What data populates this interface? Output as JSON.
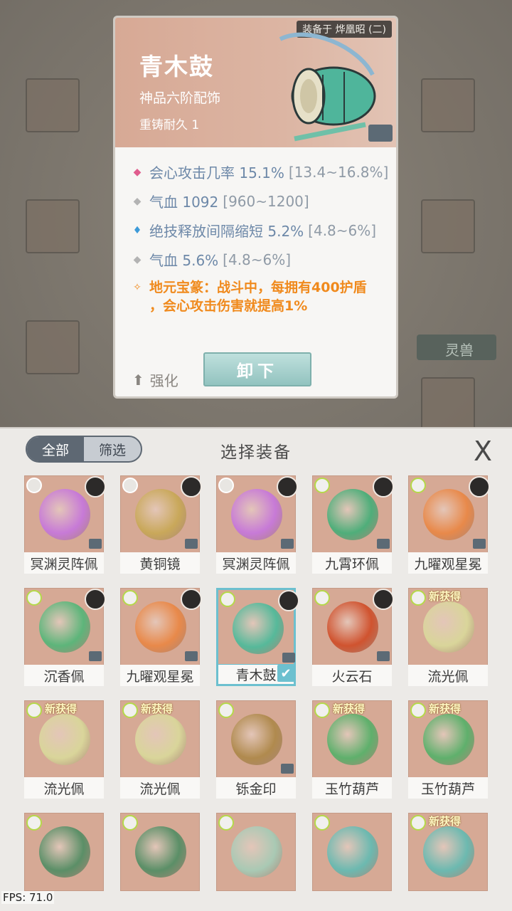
{
  "detail": {
    "equipped_by": "装备于 烨凰昭 (二)",
    "name": "青木鼓",
    "grade": "神品六阶配饰",
    "durability": "重铸耐久 1",
    "stats": [
      {
        "icon": "pink-diamond-icon",
        "color": "#e05c8d",
        "text": "会心攻击几率 15.1%",
        "range": "[13.4~16.8%]"
      },
      {
        "icon": "gray-diamond-icon",
        "color": "#b3b3b3",
        "text": "气血 1092",
        "range": "[960~1200]"
      },
      {
        "icon": "blue-flame-icon",
        "color": "#3d9ad8",
        "text": "绝技释放间隔缩短 5.2%",
        "range": "[4.8~6%]"
      },
      {
        "icon": "gray-diamond-icon",
        "color": "#b3b3b3",
        "text": "气血 5.6%",
        "range": "[4.8~6%]"
      }
    ],
    "special_line1": "地元宝篆：战斗中，每拥有400护盾",
    "special_line2": "，会心攻击伤害就提高1%",
    "enhance_label": "强化",
    "unequip_label": "卸下"
  },
  "background": {
    "tab_label": "灵兽"
  },
  "panel": {
    "filter_all": "全部",
    "filter_screen": "筛选",
    "title": "选择装备",
    "close_label": "X",
    "items": [
      {
        "label": "冥渊灵阵佩",
        "icon": "purple-orb-icon",
        "badge": "white",
        "avatar": true,
        "new": "",
        "locked": true,
        "gem_color": "#c77ad7",
        "selected": false
      },
      {
        "label": "黄铜镜",
        "icon": "bronze-mirror-icon",
        "badge": "white",
        "avatar": true,
        "new": "",
        "locked": true,
        "gem_color": "#c9a85a",
        "selected": false
      },
      {
        "label": "冥渊灵阵佩",
        "icon": "purple-orb-icon",
        "badge": "white",
        "avatar": true,
        "new": "",
        "locked": true,
        "gem_color": "#c77ad7",
        "selected": false
      },
      {
        "label": "九霄环佩",
        "icon": "jade-ring-icon",
        "badge": "green",
        "avatar": true,
        "new": "",
        "locked": true,
        "gem_color": "#4fae7a",
        "selected": false
      },
      {
        "label": "九曜观星冕",
        "icon": "flame-crown-icon",
        "badge": "green",
        "avatar": true,
        "new": "",
        "locked": true,
        "gem_color": "#e8894a",
        "selected": false
      },
      {
        "label": "沉香佩",
        "icon": "jade-pendant-icon",
        "badge": "green",
        "avatar": true,
        "new": "",
        "locked": true,
        "gem_color": "#5db57a",
        "selected": false
      },
      {
        "label": "九曜观星冕",
        "icon": "flame-crown-icon",
        "badge": "green",
        "avatar": true,
        "new": "",
        "locked": true,
        "gem_color": "#e8894a",
        "selected": false
      },
      {
        "label": "青木鼓",
        "icon": "drum-icon",
        "badge": "green",
        "avatar": true,
        "new": "",
        "locked": true,
        "gem_color": "#56b99a",
        "selected": true
      },
      {
        "label": "火云石",
        "icon": "fire-crystal-icon",
        "badge": "green",
        "avatar": true,
        "new": "",
        "locked": true,
        "gem_color": "#d0532f",
        "selected": false
      },
      {
        "label": "流光佩",
        "icon": "light-disc-icon",
        "badge": "green",
        "avatar": false,
        "new": "新获得",
        "locked": false,
        "gem_color": "#d9d59a",
        "selected": false
      },
      {
        "label": "流光佩",
        "icon": "light-disc-icon",
        "badge": "green",
        "avatar": false,
        "new": "新获得",
        "locked": false,
        "gem_color": "#d9d59a",
        "selected": false
      },
      {
        "label": "流光佩",
        "icon": "light-disc-icon",
        "badge": "green",
        "avatar": false,
        "new": "新获得",
        "locked": false,
        "gem_color": "#d9d59a",
        "selected": false
      },
      {
        "label": "铄金印",
        "icon": "golden-seal-icon",
        "badge": "green",
        "avatar": false,
        "new": "",
        "locked": true,
        "gem_color": "#b08a4e",
        "selected": false
      },
      {
        "label": "玉竹葫芦",
        "icon": "gourd-icon",
        "badge": "green",
        "avatar": false,
        "new": "新获得",
        "locked": false,
        "gem_color": "#5fb06c",
        "selected": false
      },
      {
        "label": "玉竹葫芦",
        "icon": "gourd-icon",
        "badge": "green",
        "avatar": false,
        "new": "新获得",
        "locked": false,
        "gem_color": "#5fb06c",
        "selected": false
      },
      {
        "label": "",
        "icon": "jade-lock-icon",
        "badge": "green",
        "avatar": false,
        "new": "",
        "locked": false,
        "gem_color": "#5b8f67",
        "selected": false
      },
      {
        "label": "",
        "icon": "jade-lock-icon",
        "badge": "green",
        "avatar": false,
        "new": "",
        "locked": false,
        "gem_color": "#5b8f67",
        "selected": false
      },
      {
        "label": "",
        "icon": "jade-fan-icon",
        "badge": "green",
        "avatar": false,
        "new": "",
        "locked": false,
        "gem_color": "#a9c9b4",
        "selected": false
      },
      {
        "label": "",
        "icon": "jade-knot-icon",
        "badge": "green",
        "avatar": false,
        "new": "",
        "locked": false,
        "gem_color": "#6cb9b0",
        "selected": false
      },
      {
        "label": "",
        "icon": "jade-knot-icon",
        "badge": "green",
        "avatar": false,
        "new": "新获得",
        "locked": false,
        "gem_color": "#6cb9b0",
        "selected": false
      }
    ]
  },
  "fps": "FPS: 71.0"
}
